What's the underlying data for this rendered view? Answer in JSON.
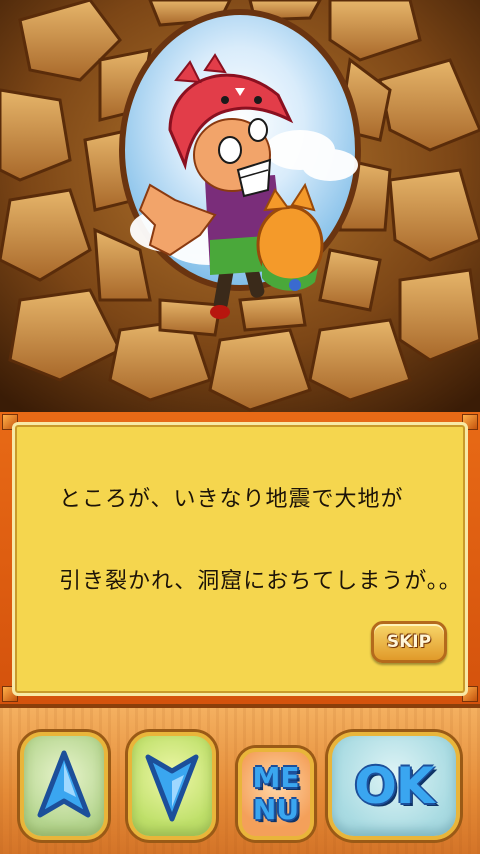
{
  "dialog": {
    "line1": "ところが、いきなり地震で大地が",
    "line2": "引き裂かれ、洞窟におちてしまうが。。",
    "skip_label": "SKIP"
  },
  "controls": {
    "menu_line1": "ME",
    "menu_line2": "NU",
    "ok_label": "OK",
    "up_icon": "up-arrow",
    "down_icon": "down-arrow"
  },
  "colors": {
    "dialog_background": "#f5d64e",
    "frame_orange": "#e86a16",
    "button_text_blue": "#2d8fe6"
  }
}
